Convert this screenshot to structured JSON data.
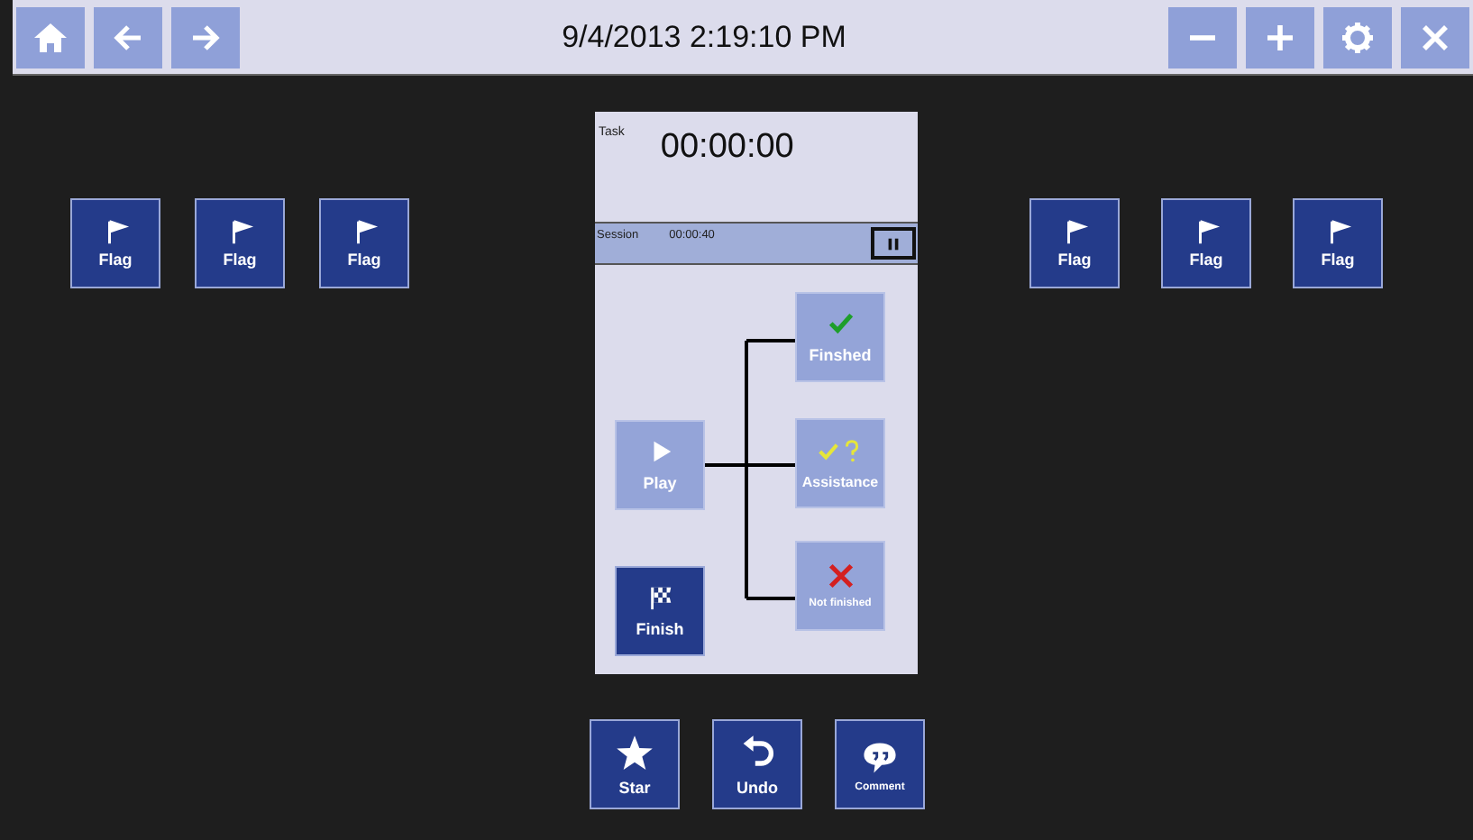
{
  "toolbar_left": [
    {
      "kind": "home"
    },
    {
      "kind": "back"
    },
    {
      "kind": "forward"
    }
  ],
  "title": "9/4/2013 2:19:10 PM",
  "toolbar_right": [
    {
      "kind": "minus"
    },
    {
      "kind": "plus"
    },
    {
      "kind": "settings"
    },
    {
      "kind": "close"
    }
  ],
  "flags_left": [
    {
      "label": "Flag"
    },
    {
      "label": "Flag"
    },
    {
      "label": "Flag"
    }
  ],
  "flags_right": [
    {
      "label": "Flag"
    },
    {
      "label": "Flag"
    },
    {
      "label": "Flag"
    }
  ],
  "panel": {
    "task_label": "Task",
    "task_time": "00:00:00",
    "session_label": "Session",
    "session_time": "00:00:40",
    "play": {
      "label": "Play",
      "disabled": true
    },
    "finish": {
      "label": "Finish",
      "disabled": false
    },
    "outcomes": [
      {
        "kind": "finished",
        "label": "Finshed",
        "disabled": true
      },
      {
        "kind": "assistance",
        "label": "Assistance",
        "disabled": true
      },
      {
        "kind": "not_finished",
        "label": "Not finished",
        "disabled": true
      }
    ]
  },
  "actions": [
    {
      "kind": "star",
      "label": "Star"
    },
    {
      "kind": "undo",
      "label": "Undo"
    },
    {
      "kind": "comment",
      "label": "Comment"
    }
  ]
}
